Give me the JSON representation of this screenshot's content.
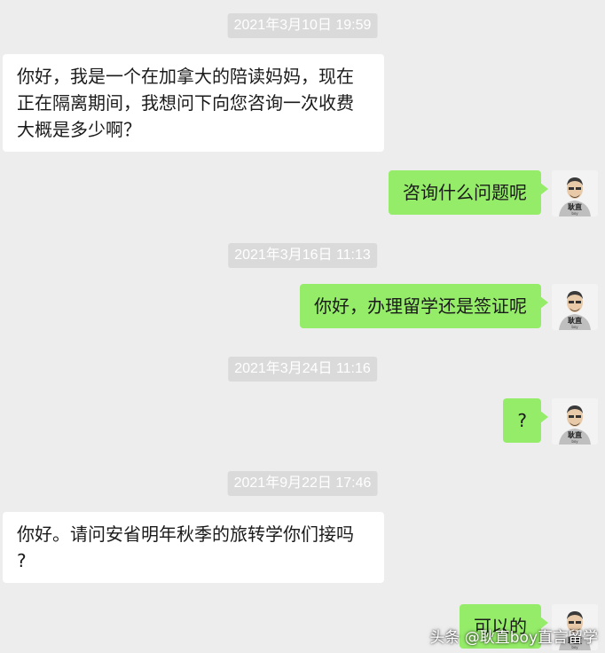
{
  "chat": {
    "timestamps": [
      "2021年3月10日 19:59",
      "2021年3月16日 11:13",
      "2021年3月24日 11:16",
      "2021年9月22日 17:46"
    ],
    "messages": [
      {
        "side": "in",
        "lines": [
          "你好，我是一个在加拿大的陪读妈妈，现在",
          "正在隔离期间，我想问下向您咨询一次收费",
          "大概是多少啊？"
        ]
      },
      {
        "side": "out",
        "text": "咨询什么问题呢"
      },
      {
        "side": "out",
        "text": "你好，办理留学还是签证呢"
      },
      {
        "side": "out",
        "text": "?"
      },
      {
        "side": "in",
        "lines": [
          "你好。请问安省明年秋季的旅转学你们接吗",
          "?"
        ]
      },
      {
        "side": "out",
        "text": "可以的"
      }
    ]
  },
  "avatar": {
    "shirt_text": "耿直",
    "shirt_subtext": "boy"
  },
  "watermark": {
    "text": "头条 @耿直boy直言留学"
  },
  "colors": {
    "background": "#ededed",
    "outgoing_bubble": "#95ec69",
    "incoming_bubble": "#ffffff",
    "timestamp_bg": "#dadada"
  }
}
